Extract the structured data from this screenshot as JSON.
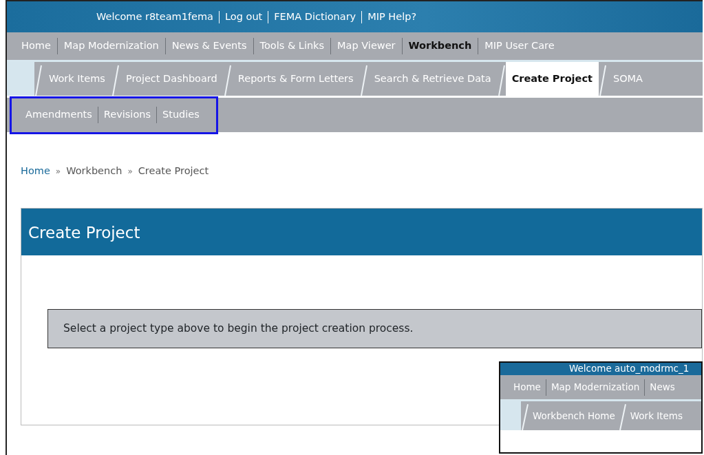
{
  "top_links": [
    "Welcome r8team1fema",
    "Log out",
    "FEMA Dictionary",
    "MIP Help?"
  ],
  "main_nav": [
    {
      "label": "Home",
      "selected": false
    },
    {
      "label": "Map Modernization",
      "selected": false
    },
    {
      "label": "News & Events",
      "selected": false
    },
    {
      "label": "Tools & Links",
      "selected": false
    },
    {
      "label": "Map Viewer",
      "selected": false
    },
    {
      "label": "Workbench",
      "selected": true
    },
    {
      "label": "MIP User Care",
      "selected": false
    }
  ],
  "tabs": [
    {
      "label": "Work Items",
      "selected": false
    },
    {
      "label": "Project Dashboard",
      "selected": false
    },
    {
      "label": "Reports & Form Letters",
      "selected": false
    },
    {
      "label": "Search & Retrieve Data",
      "selected": false
    },
    {
      "label": "Create Project",
      "selected": true
    },
    {
      "label": "SOMA",
      "selected": false
    }
  ],
  "subnav": {
    "highlighted": true,
    "items": [
      "Amendments",
      "Revisions",
      "Studies"
    ]
  },
  "breadcrumb": [
    {
      "kind": "link",
      "text": "Home"
    },
    {
      "kind": "separator",
      "text": "»"
    },
    {
      "kind": "item",
      "text": "Workbench"
    },
    {
      "kind": "separator",
      "text": "»"
    },
    {
      "kind": "item",
      "text": "Create Project"
    }
  ],
  "panel": {
    "title": "Create Project",
    "message": "Select a project type above to begin the project creation process."
  },
  "inset": {
    "top_text": "Welcome auto_modrmc_1",
    "main_nav": [
      "Home",
      "Map Modernization",
      "News"
    ],
    "tabs": [
      "Workbench Home",
      "Work Items"
    ]
  }
}
